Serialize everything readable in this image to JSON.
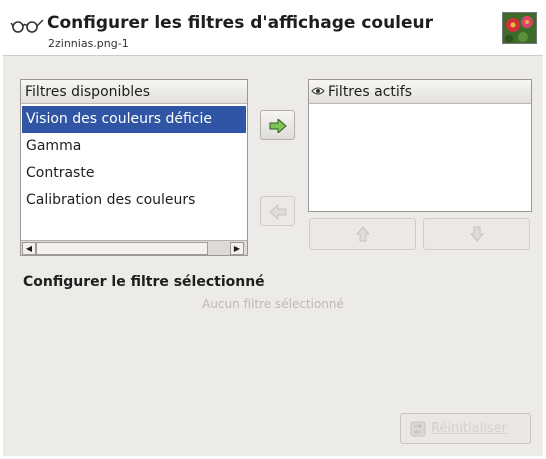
{
  "header": {
    "title": "Configurer les filtres d'affichage couleur",
    "subtitle": "2zinnias.png-1",
    "icon": "glasses-icon"
  },
  "available": {
    "header": "Filtres disponibles",
    "items": [
      {
        "label": "Vision des couleurs déficie",
        "selected": true
      },
      {
        "label": "Gamma",
        "selected": false
      },
      {
        "label": "Contraste",
        "selected": false
      },
      {
        "label": "Calibration des couleurs",
        "selected": false
      }
    ]
  },
  "active": {
    "header": "Filtres actifs",
    "header_icon": "eye-icon"
  },
  "buttons": {
    "add": "arrow-right-icon",
    "remove": "arrow-left-icon",
    "up": "arrow-up-icon",
    "down": "arrow-down-icon"
  },
  "config": {
    "title": "Configurer le filtre sélectionné",
    "empty_message": "Aucun filtre sélectionné",
    "reset_label": "Réinitialiser"
  },
  "colors": {
    "selection": "#2f55a4",
    "background": "#edebe8"
  }
}
